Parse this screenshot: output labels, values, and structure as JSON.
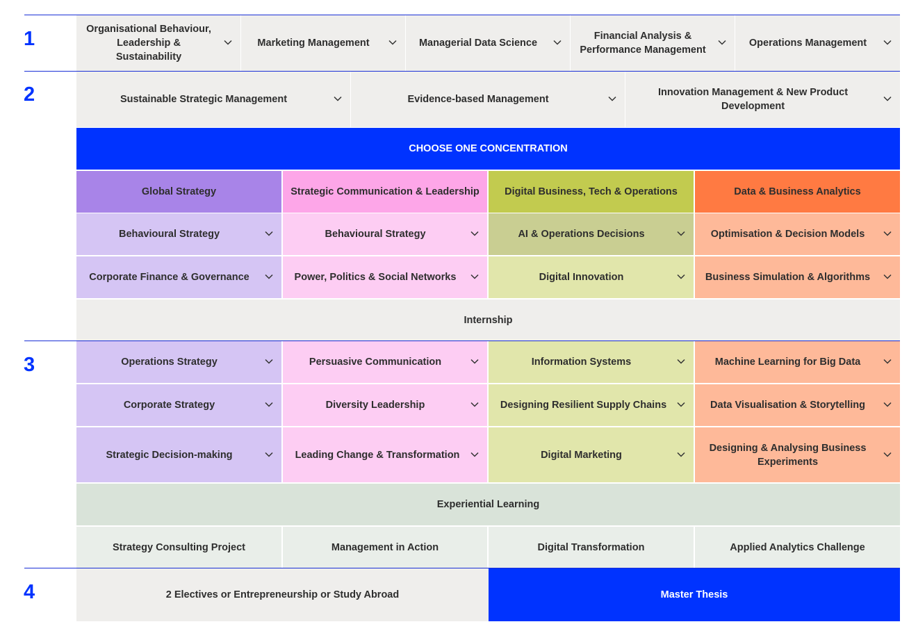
{
  "years": {
    "y1": "1",
    "y2": "2",
    "y3": "3",
    "y4": "4"
  },
  "term1": {
    "courses": [
      "Organisational Behaviour, Leadership & Sustainability",
      "Marketing Management",
      "Managerial Data Science",
      "Financial Analysis & Performance Management",
      "Operations Management"
    ]
  },
  "term2": {
    "courses": [
      "Sustainable Strategic Management",
      "Evidence-based Management",
      "Innovation Management & New Product Development"
    ],
    "choose_banner": "CHOOSE ONE CONCENTRATION",
    "concentrations": [
      "Global Strategy",
      "Strategic Communication & Leadership",
      "Digital Business, Tech & Operations",
      "Data & Business Analytics"
    ],
    "row1": [
      "Behavioural Strategy",
      "Behavioural Strategy",
      "AI & Operations Decisions",
      "Optimisation & Decision Models"
    ],
    "row2": [
      "Corporate Finance & Governance",
      "Power, Politics & Social Networks",
      "Digital Innovation",
      "Business Simulation & Algorithms"
    ],
    "internship": "Internship"
  },
  "term3": {
    "row1": [
      "Operations Strategy",
      "Persuasive Communication",
      "Information Systems",
      "Machine Learning for Big Data"
    ],
    "row2": [
      "Corporate Strategy",
      "Diversity Leadership",
      "Designing Resilient Supply Chains",
      "Data Visualisation & Storytelling"
    ],
    "row3": [
      "Strategic Decision-making",
      "Leading Change & Transformation",
      "Digital Marketing",
      "Designing & Analysing Business Experiments"
    ],
    "experiential": "Experiential Learning",
    "projects": [
      "Strategy Consulting Project",
      "Management in Action",
      "Digital Transformation",
      "Applied Analytics Challenge"
    ]
  },
  "term4": {
    "electives": "2 Electives or Entrepreneurship or Study Abroad",
    "thesis": "Master Thesis"
  },
  "colors": {
    "accent_blue": "#0033ff",
    "global_strategy": "#a884e8",
    "strategic_communication": "#fda6e8",
    "digital_business": "#c2cb4f",
    "data_analytics": "#ff7a42"
  }
}
